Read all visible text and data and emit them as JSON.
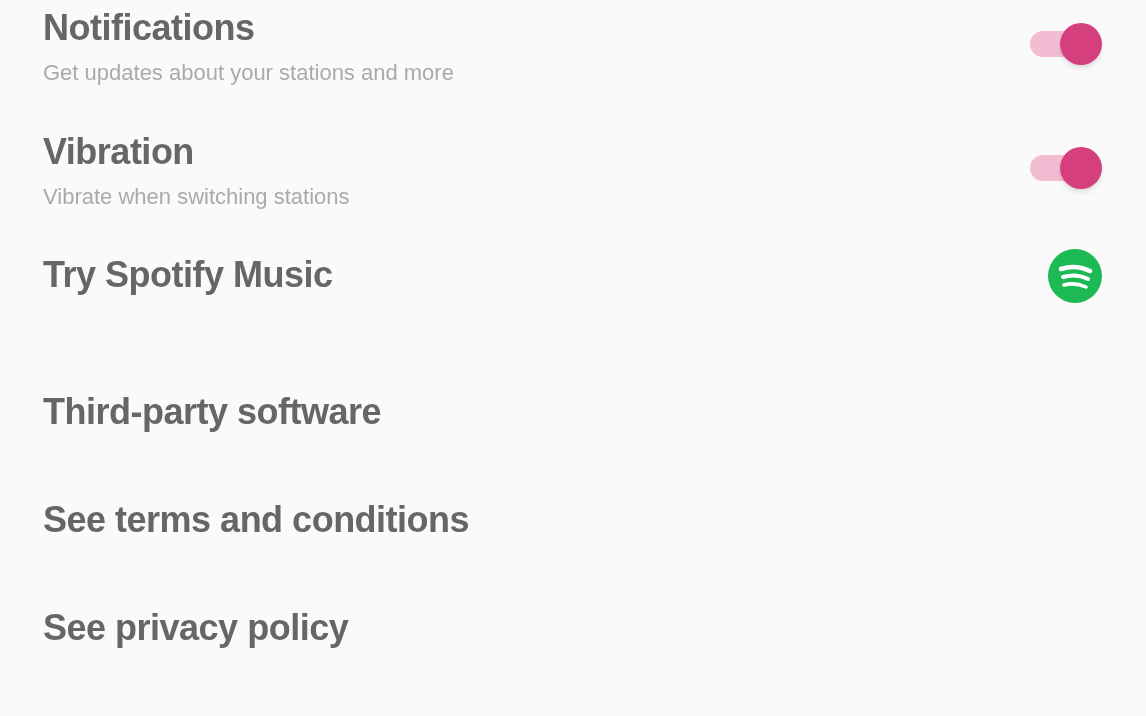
{
  "settings": [
    {
      "kind": "toggle",
      "title": "Notifications",
      "subtitle": "Get updates about your stations and more",
      "on": true
    },
    {
      "kind": "toggle",
      "title": "Vibration",
      "subtitle": "Vibrate when switching stations",
      "on": true
    },
    {
      "kind": "logo",
      "title": "Try Spotify Music"
    }
  ],
  "links": [
    "Third-party software",
    "See terms and conditions",
    "See privacy policy"
  ]
}
